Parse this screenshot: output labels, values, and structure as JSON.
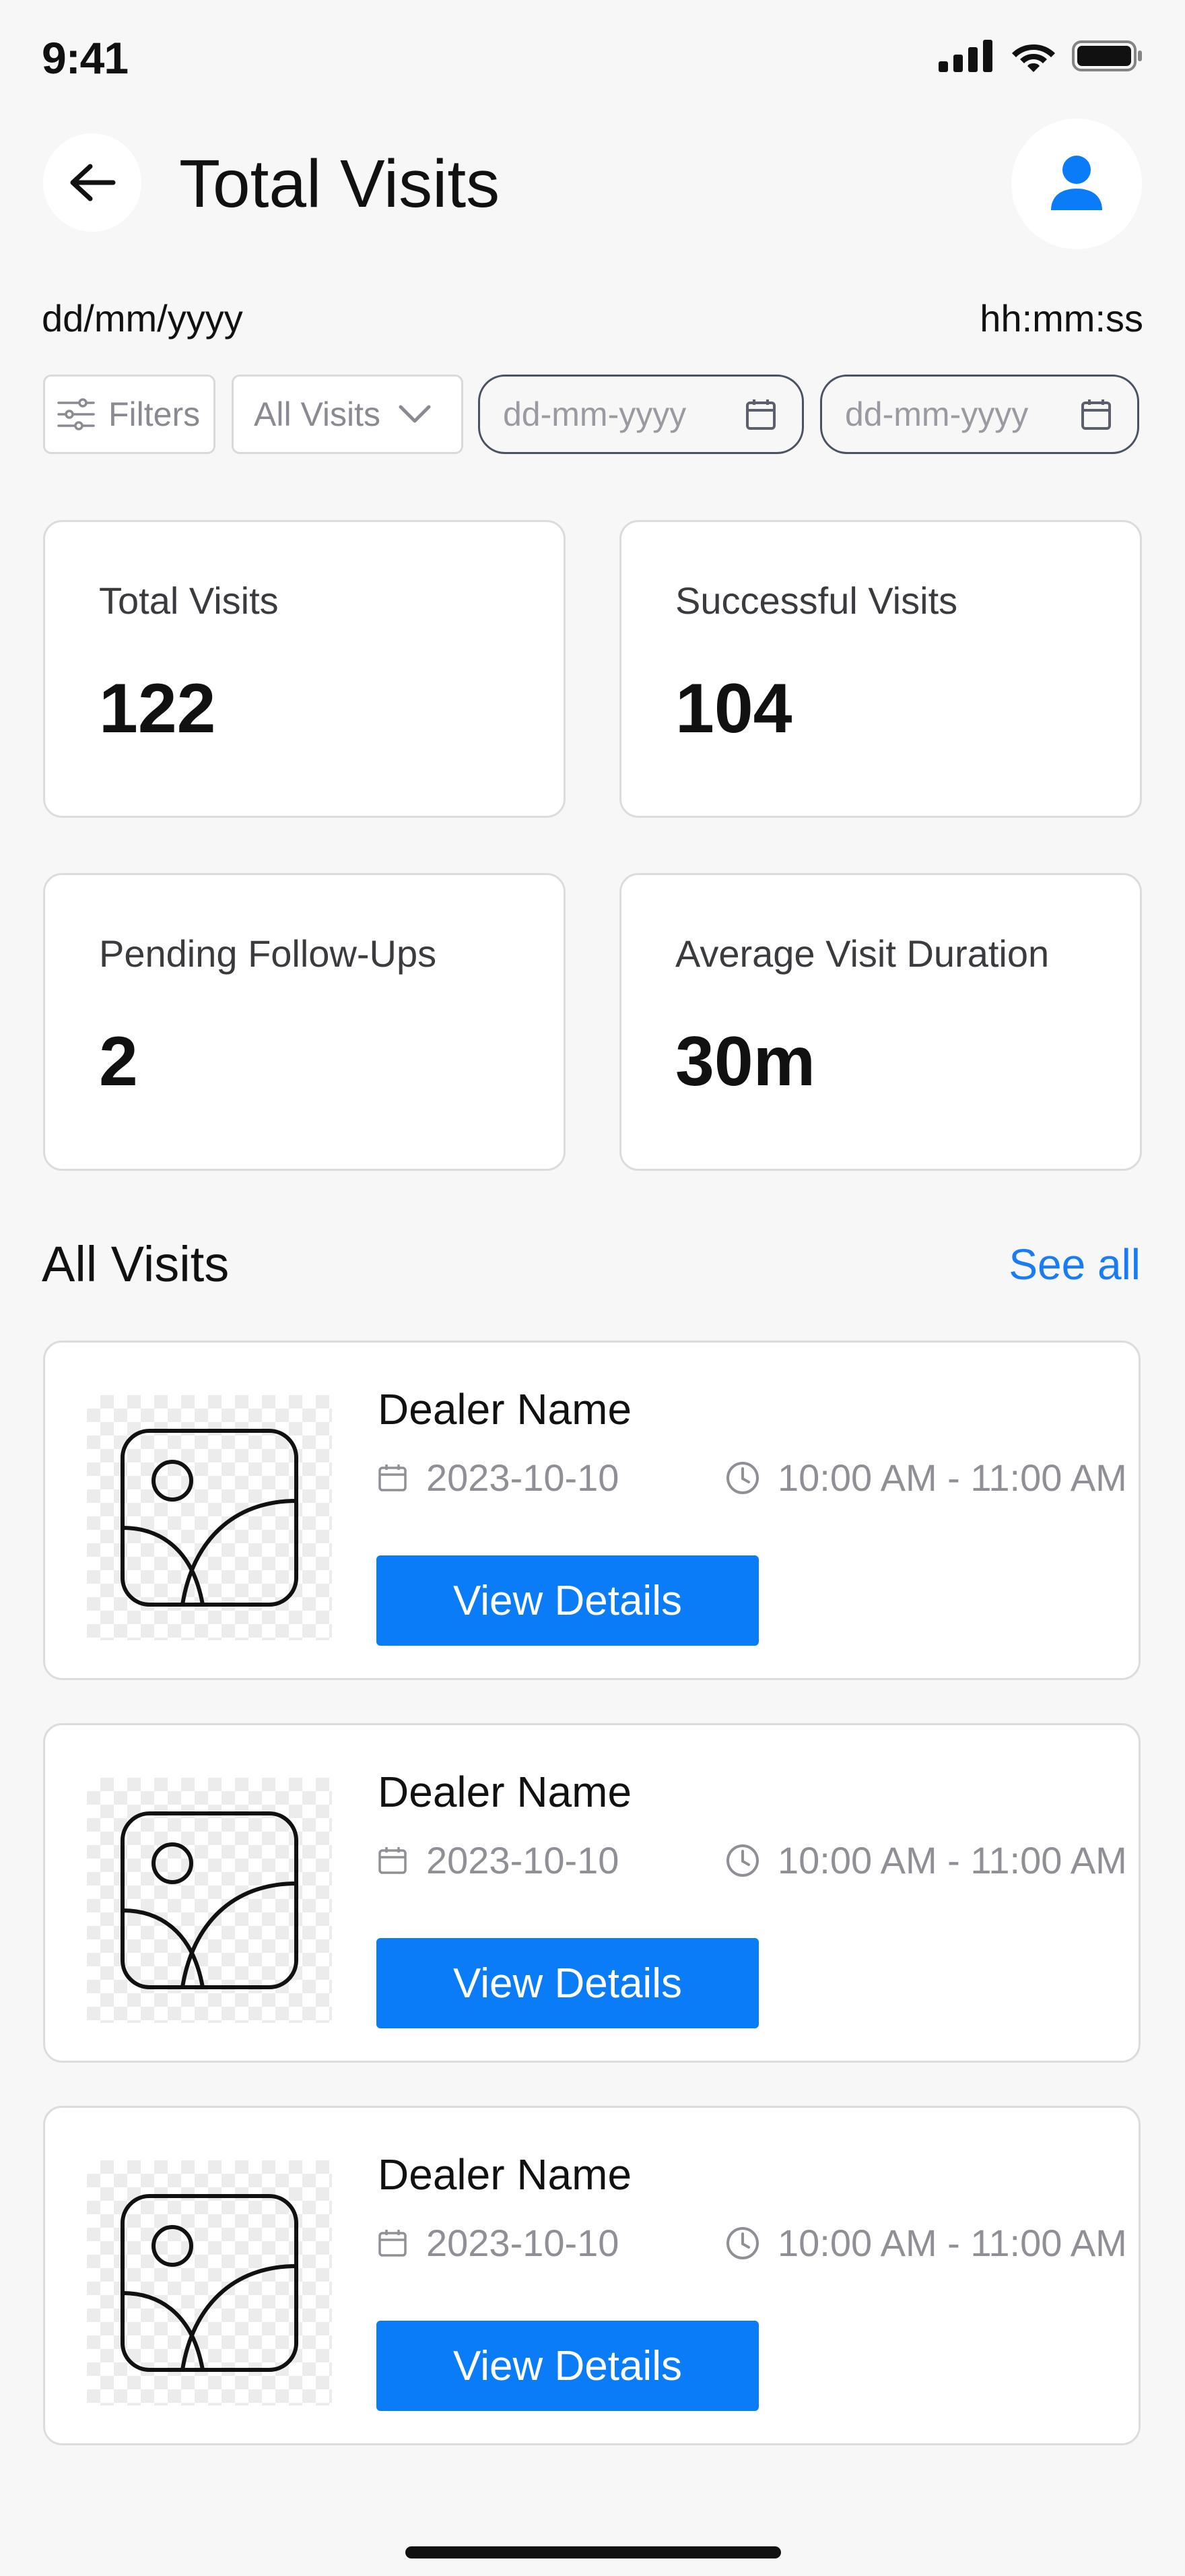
{
  "status_bar": {
    "time": "9:41",
    "icons": [
      "signal-icon",
      "wifi-icon",
      "battery-icon"
    ]
  },
  "header": {
    "title": "Total Visits",
    "back_icon": "arrow-left-icon",
    "profile_icon": "user-icon"
  },
  "datetime": {
    "date": "dd/mm/yyyy",
    "time": "hh:mm:ss"
  },
  "filters": {
    "filters_label": "Filters",
    "visits_select": "All Visits",
    "from_date_placeholder": "dd-mm-yyyy",
    "to_date_placeholder": "dd-mm-yyyy"
  },
  "stats": [
    {
      "label": "Total Visits",
      "value": "122"
    },
    {
      "label": "Successful Visits",
      "value": "104"
    },
    {
      "label": "Pending Follow-Ups",
      "value": "2"
    },
    {
      "label": "Average Visit Duration",
      "value": "30m"
    }
  ],
  "visits_section": {
    "title": "All Visits",
    "see_all": "See all"
  },
  "visits": [
    {
      "dealer": "Dealer Name",
      "date": "2023-10-10",
      "time": "10:00 AM - 11:00 AM",
      "button": "View Details"
    },
    {
      "dealer": "Dealer Name",
      "date": "2023-10-10",
      "time": "10:00 AM - 11:00 AM",
      "button": "View Details"
    },
    {
      "dealer": "Dealer Name",
      "date": "2023-10-10",
      "time": "10:00 AM - 11:00 AM",
      "button": "View Details"
    }
  ],
  "colors": {
    "accent": "#0a7cf8",
    "link": "#1a7cf5",
    "background": "#f7f7f8",
    "card_border": "#dcdce0"
  }
}
